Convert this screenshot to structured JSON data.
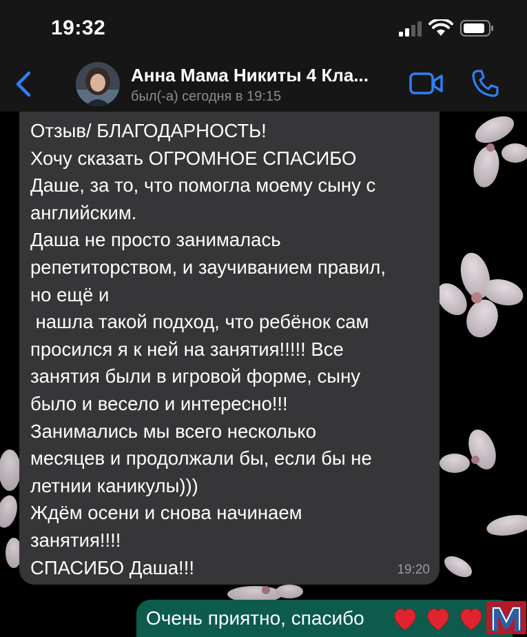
{
  "status_bar": {
    "time": "19:32",
    "signal_icon": "cellular-signal-icon",
    "wifi_icon": "wifi-icon",
    "battery_icon": "battery-icon"
  },
  "header": {
    "contact_name": "Анна Мама Никиты 4 Кла...",
    "last_seen": "был(-а) сегодня в 19:15",
    "back_icon": "chevron-left-icon",
    "video_icon": "video-camera-icon",
    "call_icon": "phone-icon"
  },
  "messages": [
    {
      "direction": "incoming",
      "text": "Отзыв/ БЛАГОДАРНОСТЬ!\nХочу сказать ОГРОМНОЕ СПАСИБО\nДаше, за то, что помогла моему сыну с\nанглийским.\nДаша не просто занималась\nрепетиторством, и заучиванием правил,\nно ещё и\n нашла такой подход, что ребёнок сам\nпросился я к ней на занятия!!!!! Все\nзанятия были в игровой форме, сыну\nбыло и весело и интересно!!!\nЗанимались мы всего несколько\nмесяцев и продолжали бы, если бы не\nлетнии каникулы)))\nЖдём осени и снова начинаем\nзанятия!!!!\nСПАСИБО Даша!!!",
      "time": "19:20"
    },
    {
      "direction": "outgoing",
      "text": "Очень приятно, спасибо",
      "emoji": "❤️❤️❤️"
    }
  ],
  "colors": {
    "incoming_bubble": "#363638",
    "outgoing_bubble": "#0c5b4d",
    "accent": "#2f7ff7",
    "status_gray": "#8d8d92"
  }
}
